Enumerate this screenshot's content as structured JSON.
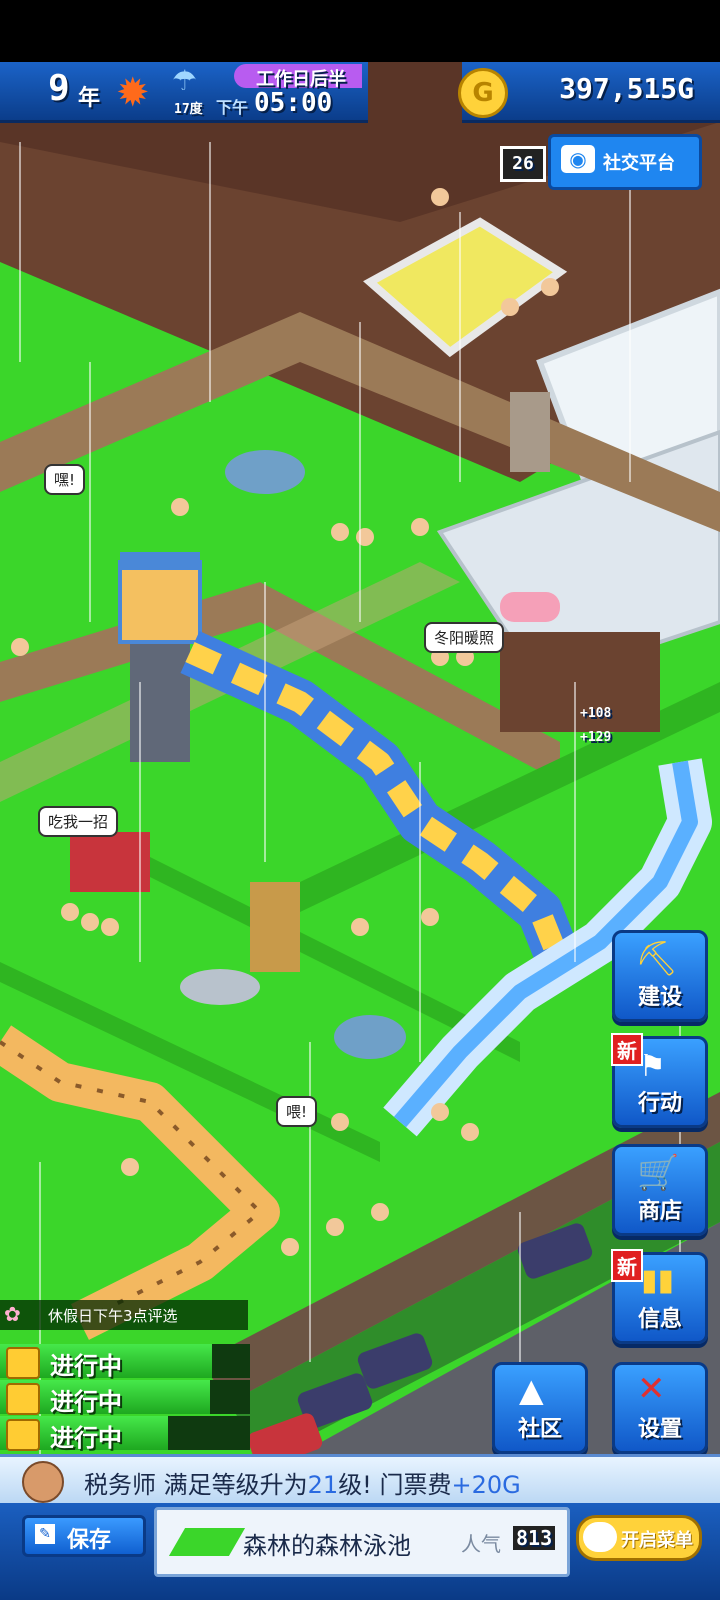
{
  "hud": {
    "year_num": "9",
    "year_unit": "年",
    "temp": "17度",
    "period": "工作日后半",
    "ampm": "下午",
    "time": "05:00",
    "money": "397,515G",
    "day_badge": "26",
    "social_label": "社交平台"
  },
  "bubbles": [
    "嘿!",
    "冬阳暖照",
    "吃我一招",
    "喂!"
  ],
  "float_values": [
    "+108",
    "+129"
  ],
  "side_buttons": [
    {
      "label": "建设",
      "new": ""
    },
    {
      "label": "行动",
      "new": "新"
    },
    {
      "label": "商店",
      "new": ""
    },
    {
      "label": "信息",
      "new": "新"
    }
  ],
  "bottom_right_buttons": [
    "社区",
    "设置"
  ],
  "event": {
    "title": "休假日下午3点评选",
    "items": [
      "进行中",
      "进行中",
      "进行中"
    ]
  },
  "ticker": {
    "job": "税务师",
    "text_a": "满足等级升为",
    "level": "21",
    "text_b": "级!",
    "text_c": "门票费",
    "fee": "+20G"
  },
  "footer": {
    "save": "保存",
    "park_name": "森林的森林泳池",
    "popularity_label": "人气",
    "popularity_value": "813",
    "menu": "开启菜单"
  },
  "colors": {
    "grass": "#3bd62a",
    "hud_blue": "#1b63c8",
    "water": "#4aa8ff",
    "slide_yellow": "#ffd24a"
  }
}
